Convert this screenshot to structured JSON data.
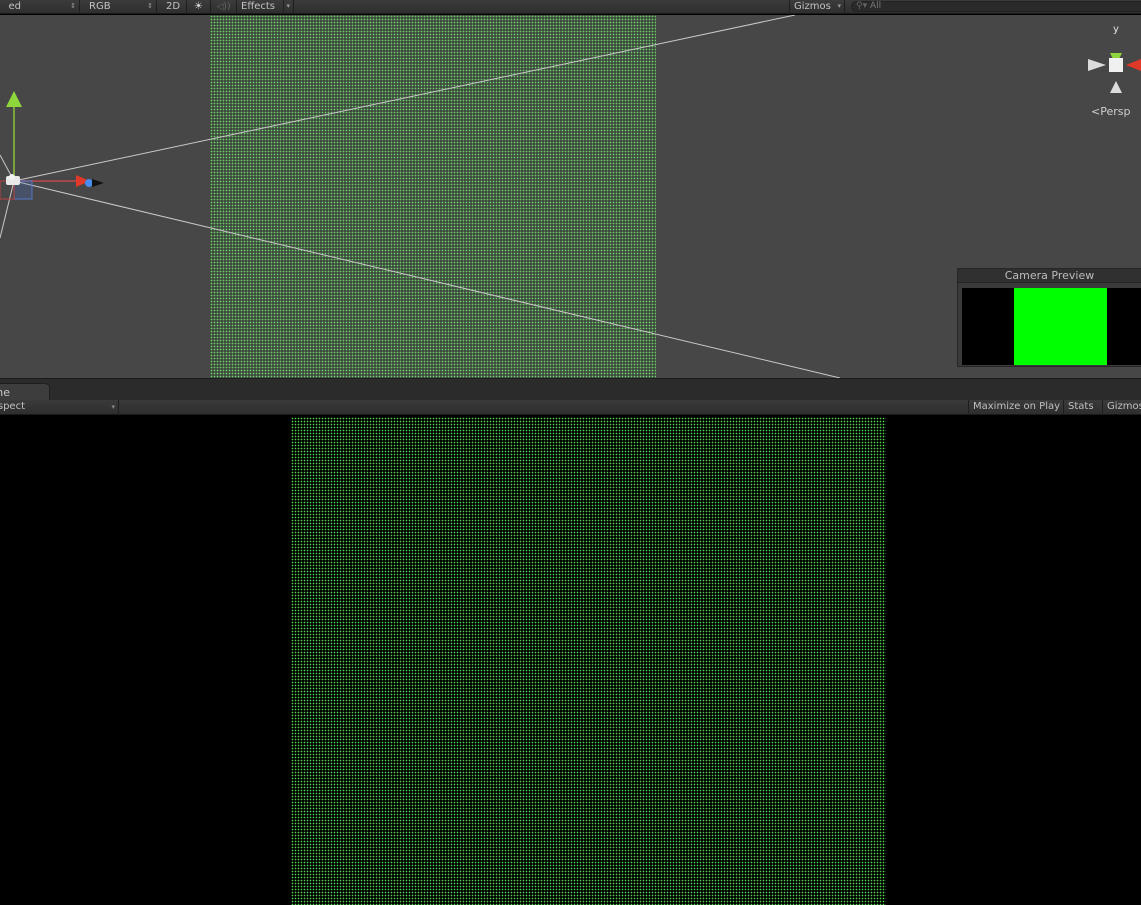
{
  "scene_toolbar": {
    "draw_mode": "ed",
    "render_mode": "RGB",
    "mode_2d": "2D",
    "lighting_icon": "sun-icon",
    "audio_icon": "speaker-icon",
    "effects_label": "Effects",
    "gizmos_label": "Gizmos",
    "search_placeholder": "All"
  },
  "scene_view": {
    "persp_label": "Persp",
    "gizmo_axis_y": "y",
    "camera_preview_title": "Camera Preview",
    "colors": {
      "background": "#474747",
      "point_grid": "#6fd26f",
      "preview_fill": "#00ff00"
    }
  },
  "game_panel": {
    "tab_label": "Game",
    "aspect_label": "Free Aspect",
    "maximize_on_play": "Maximize on Play",
    "stats": "Stats",
    "gizmos": "Gizmos",
    "colors": {
      "background": "#000000",
      "point_grid": "#52d152"
    }
  }
}
